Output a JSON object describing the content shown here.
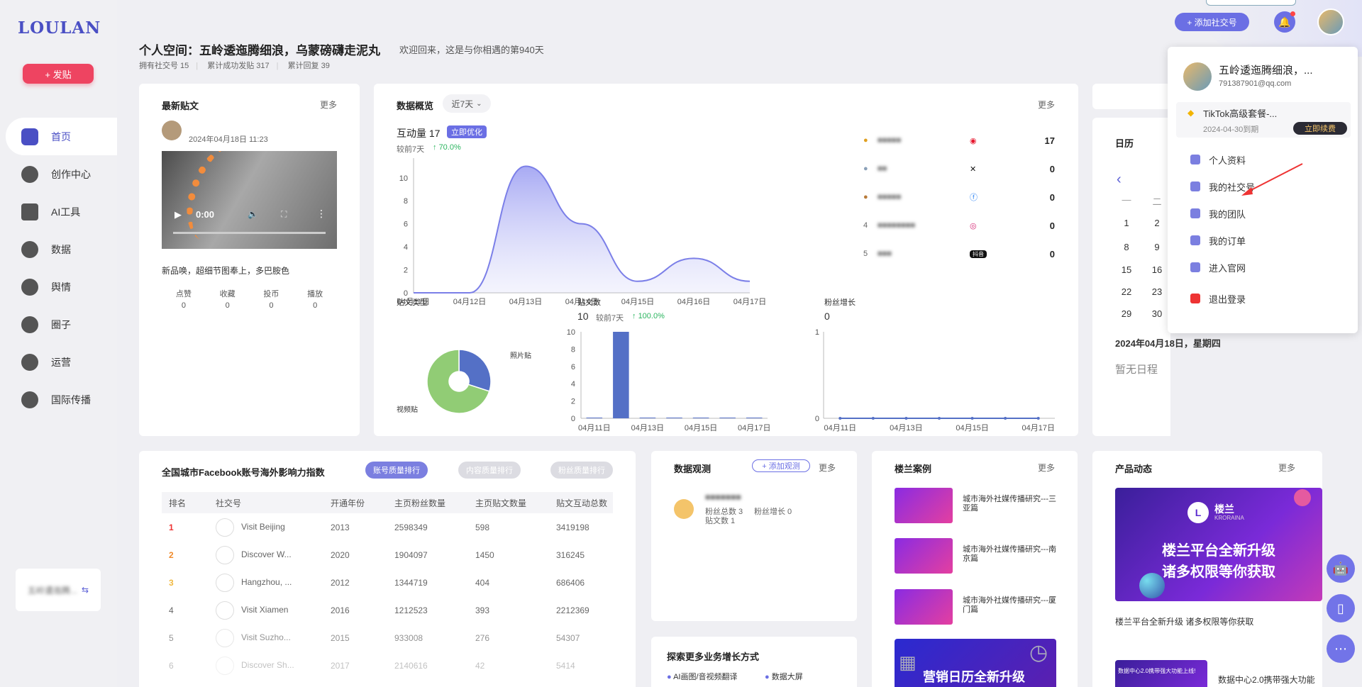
{
  "app": {
    "logo": "LOULAN",
    "post_button": "+ 发贴"
  },
  "nav": [
    {
      "label": "首页",
      "icon": "home-icon",
      "active": true
    },
    {
      "label": "创作中心",
      "icon": "palette-icon"
    },
    {
      "label": "AI工具",
      "icon": "ai-icon"
    },
    {
      "label": "数据",
      "icon": "database-icon"
    },
    {
      "label": "舆情",
      "icon": "quote-icon"
    },
    {
      "label": "圈子",
      "icon": "compass-icon"
    },
    {
      "label": "运营",
      "icon": "shield-icon"
    },
    {
      "label": "国际传播",
      "icon": "globe-icon"
    }
  ],
  "sidebar_bottom": {
    "text": "五岭逶迤腾...",
    "icon": "swap-icon"
  },
  "header": {
    "title": "个人空间：五岭逶迤腾细浪，乌蒙磅礴走泥丸",
    "welcome": "欢迎回来，这是与你相遇的第940天",
    "stats": [
      "拥有社交号 15",
      "累计成功发贴 317",
      "累计回复 39"
    ],
    "add_social": "+ 添加社交号"
  },
  "latest_post": {
    "title": "最新贴文",
    "more": "更多",
    "date": "2024年04月18日 11:23",
    "video_time": "0:00",
    "caption": "新品唤，超细节图奉上，多巴胺色",
    "metrics": [
      {
        "label": "点赞",
        "value": "0"
      },
      {
        "label": "收藏",
        "value": "0"
      },
      {
        "label": "投币",
        "value": "0"
      },
      {
        "label": "播放",
        "value": "0"
      }
    ]
  },
  "overview": {
    "title": "数据概览",
    "range": "近7天",
    "more": "更多",
    "interaction_label": "互动量 17",
    "optimize": "立即优化",
    "compare": "较前7天",
    "change": "70.0%",
    "dates": [
      "04月11日",
      "04月12日",
      "04月13日",
      "04月14日",
      "04月15日",
      "04月16日",
      "04月17日"
    ],
    "accounts": [
      {
        "rank": "1",
        "value": "17",
        "platform": "weibo"
      },
      {
        "rank": "2",
        "value": "0",
        "platform": "x"
      },
      {
        "rank": "3",
        "value": "0",
        "platform": "facebook"
      },
      {
        "rank": "4",
        "value": "0",
        "platform": "instagram"
      },
      {
        "rank": "5",
        "value": "0",
        "platform": "抖音"
      }
    ],
    "post_type": {
      "title": "贴文类型",
      "photo": "照片贴",
      "video": "视频贴"
    },
    "post_count": {
      "title": "贴文数",
      "value": "10",
      "compare": "较前7天",
      "change": "100.0%"
    },
    "fans": {
      "title": "粉丝增长",
      "value": "0"
    }
  },
  "chart_data": [
    {
      "type": "area",
      "x": [
        "04月11日",
        "04月12日",
        "04月13日",
        "04月14日",
        "04月15日",
        "04月16日",
        "04月17日"
      ],
      "values": [
        0,
        0,
        11,
        6,
        1,
        3,
        1
      ],
      "ylim": [
        0,
        12
      ],
      "yticks": [
        0,
        2,
        4,
        6,
        8,
        10,
        12
      ]
    },
    {
      "type": "pie",
      "categories": [
        "照片贴",
        "视频贴"
      ],
      "values": [
        3,
        7
      ]
    },
    {
      "type": "bar",
      "x": [
        "04月11日",
        "04月12日",
        "04月13日",
        "04月14日",
        "04月15日",
        "04月16日",
        "04月17日"
      ],
      "values": [
        0,
        10,
        0,
        0,
        0,
        0,
        0
      ],
      "ylim": [
        0,
        10
      ],
      "yticks": [
        0,
        2,
        4,
        6,
        8,
        10
      ]
    },
    {
      "type": "line",
      "x": [
        "04月11日",
        "04月12日",
        "04月13日",
        "04月14日",
        "04月15日",
        "04月16日",
        "04月17日"
      ],
      "values": [
        0,
        0,
        0,
        0,
        0,
        0,
        0
      ],
      "ylim": [
        0,
        1
      ],
      "yticks": [
        0,
        1
      ]
    }
  ],
  "calendar": {
    "title": "日历",
    "weekday_hint": [
      "—",
      "二"
    ],
    "rows": [
      [
        "1",
        "2"
      ],
      [
        "8",
        "9"
      ],
      [
        "15",
        "16"
      ],
      [
        "22",
        "23"
      ],
      [
        "29",
        "30"
      ]
    ],
    "selected_date": "2024年04月18日，星期四",
    "empty": "暂无日程"
  },
  "dropdown": {
    "name": "五岭逶迤腾细浪，...",
    "email": "791387901@qq.com",
    "plan": "TikTok高级套餐-...",
    "expire": "2024-04-30到期",
    "renew": "立即续费",
    "items": [
      {
        "label": "个人资料",
        "icon": "user-icon"
      },
      {
        "label": "我的社交号",
        "icon": "id-card-icon"
      },
      {
        "label": "我的团队",
        "icon": "team-icon"
      },
      {
        "label": "我的订单",
        "icon": "order-icon"
      },
      {
        "label": "进入官网",
        "icon": "website-icon"
      },
      {
        "label": "退出登录",
        "icon": "logout-icon"
      }
    ]
  },
  "ranking": {
    "title": "全国城市Facebook账号海外影响力指数",
    "tabs": [
      "账号质量排行",
      "内容质量排行",
      "粉丝质量排行"
    ],
    "columns": [
      "排名",
      "社交号",
      "开通年份",
      "主页粉丝数量",
      "主页贴文数量",
      "贴文互动总数"
    ],
    "rows": [
      [
        "1",
        "Visit Beijing",
        "2013",
        "2598349",
        "598",
        "3419198"
      ],
      [
        "2",
        "Discover W...",
        "2020",
        "1904097",
        "1450",
        "316245"
      ],
      [
        "3",
        "Hangzhou, ...",
        "2012",
        "1344719",
        "404",
        "686406"
      ],
      [
        "4",
        "Visit Xiamen",
        "2016",
        "1212523",
        "393",
        "2212369"
      ],
      [
        "5",
        "Visit Suzho...",
        "2015",
        "933008",
        "276",
        "54307"
      ],
      [
        "6",
        "Discover Sh...",
        "2017",
        "2140616",
        "42",
        "5414"
      ]
    ]
  },
  "observe": {
    "title": "数据观测",
    "add": "+ 添加观测",
    "more": "更多",
    "fans_total": "粉丝总数 3",
    "fans_growth": "粉丝增长 0",
    "posts": "贴文数 1"
  },
  "explore": {
    "title": "探索更多业务增长方式",
    "items": [
      "AI画图/音视频翻译",
      "数据大屏"
    ]
  },
  "cases": {
    "title": "楼兰案例",
    "more": "更多",
    "items": [
      "城市海外社媒传播研究---三亚篇",
      "城市海外社媒传播研究---南京篇",
      "城市海外社媒传播研究---厦门篇"
    ],
    "banner": "营销日历全新升级"
  },
  "product": {
    "title": "产品动态",
    "more": "更多",
    "banner_brand": "楼兰",
    "banner_brand_en": "KRORAINA",
    "banner_line1": "楼兰平台全新升级",
    "banner_line2": "诸多权限等你获取",
    "caption": "楼兰平台全新升级 诸多权限等你获取",
    "second_thumb": "数据中心2.0携带强大功能上线!",
    "second": "数据中心2.0携带强大功能"
  },
  "colors": {
    "accent": "#5b5fd6",
    "brand": "#4a4fc4",
    "post": "#ee4461",
    "green": "#2bb55f",
    "bar": "#5470c6",
    "pie_video": "#91cc75"
  }
}
